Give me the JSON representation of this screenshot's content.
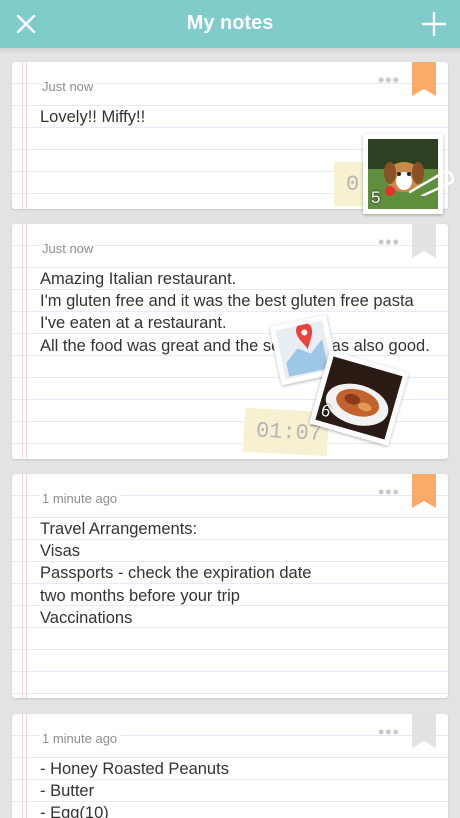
{
  "header": {
    "title": "My notes",
    "close_icon": "close-icon",
    "add_icon": "plus-icon",
    "color": "#7fcccb"
  },
  "notes": [
    {
      "time": "Just now",
      "text": "Lovely!! Miffy!!",
      "bookmarked": true,
      "time_stamp": "0",
      "photo_count": "5"
    },
    {
      "time": "Just now",
      "text": "Amazing Italian restaurant.\nI'm gluten free and it was the best gluten free pasta I've eaten at a restaurant.\nAll the food was great and the service was also good.",
      "bookmarked": false,
      "time_stamp": "01:07",
      "photo_count": "6"
    },
    {
      "time": "1 minute ago",
      "text": "Travel Arrangements:\nVisas\nPassports - check the expiration date two months before your trip\nVaccinations",
      "bookmarked": true
    },
    {
      "time": "1 minute ago",
      "text": "- Honey Roasted Peanuts\n- Butter\n- Egg(10)",
      "bookmarked": false
    }
  ],
  "menu_glyph": "•••",
  "colors": {
    "bookmark_active": "#f9ab67",
    "bookmark_inactive": "#e2e2e2",
    "background": "#e3e3e3"
  }
}
